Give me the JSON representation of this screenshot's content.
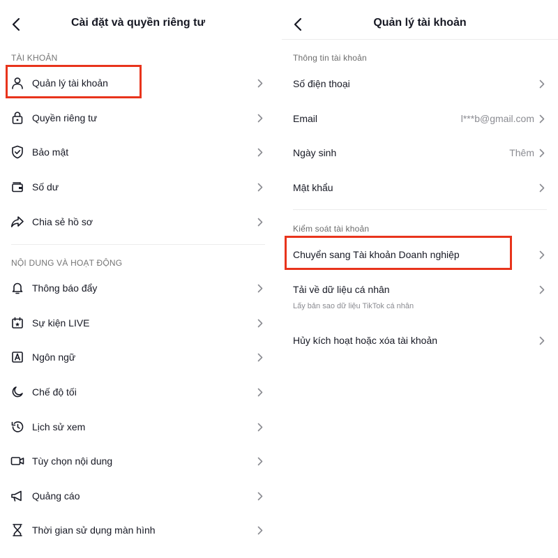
{
  "left": {
    "header": {
      "title": "Cài đặt và quyền riêng tư"
    },
    "sections": [
      {
        "label": "TÀI KHOẢN",
        "items": [
          {
            "label": "Quản lý tài khoản",
            "icon": "person-icon"
          },
          {
            "label": "Quyền riêng tư",
            "icon": "lock-icon"
          },
          {
            "label": "Bảo mật",
            "icon": "shield-icon"
          },
          {
            "label": "Số dư",
            "icon": "wallet-icon"
          },
          {
            "label": "Chia sẻ hồ sơ",
            "icon": "share-icon"
          }
        ]
      },
      {
        "label": "NỘI DUNG VÀ HOẠT ĐỘNG",
        "items": [
          {
            "label": "Thông báo đẩy",
            "icon": "bell-icon"
          },
          {
            "label": "Sự kiện LIVE",
            "icon": "calendar-icon"
          },
          {
            "label": "Ngôn ngữ",
            "icon": "language-icon"
          },
          {
            "label": "Chế độ tối",
            "icon": "moon-icon"
          },
          {
            "label": "Lịch sử xem",
            "icon": "history-icon"
          },
          {
            "label": "Tùy chọn nội dung",
            "icon": "video-icon"
          },
          {
            "label": "Quảng cáo",
            "icon": "megaphone-icon"
          },
          {
            "label": "Thời gian sử dụng màn hình",
            "icon": "hourglass-icon"
          }
        ]
      }
    ]
  },
  "right": {
    "header": {
      "title": "Quản lý tài khoản"
    },
    "sections": [
      {
        "label": "Thông tin tài khoản",
        "items": [
          {
            "label": "Số điện thoại",
            "value": ""
          },
          {
            "label": "Email",
            "value": "l***b@gmail.com"
          },
          {
            "label": "Ngày sinh",
            "value": "Thêm"
          },
          {
            "label": "Mật khẩu",
            "value": ""
          }
        ]
      },
      {
        "label": "Kiểm soát tài khoản",
        "items": [
          {
            "label": "Chuyển sang Tài khoản Doanh nghiệp",
            "value": ""
          },
          {
            "label": "Tải về dữ liệu cá nhân",
            "value": "",
            "subtext": "Lấy bản sao dữ liệu TikTok cá nhân"
          },
          {
            "label": "Hủy kích hoạt hoặc xóa tài khoản",
            "value": ""
          }
        ]
      }
    ]
  },
  "colors": {
    "highlight": "#e8341c",
    "text": "#161823",
    "muted": "#8a8b91",
    "divider": "#ececec"
  }
}
